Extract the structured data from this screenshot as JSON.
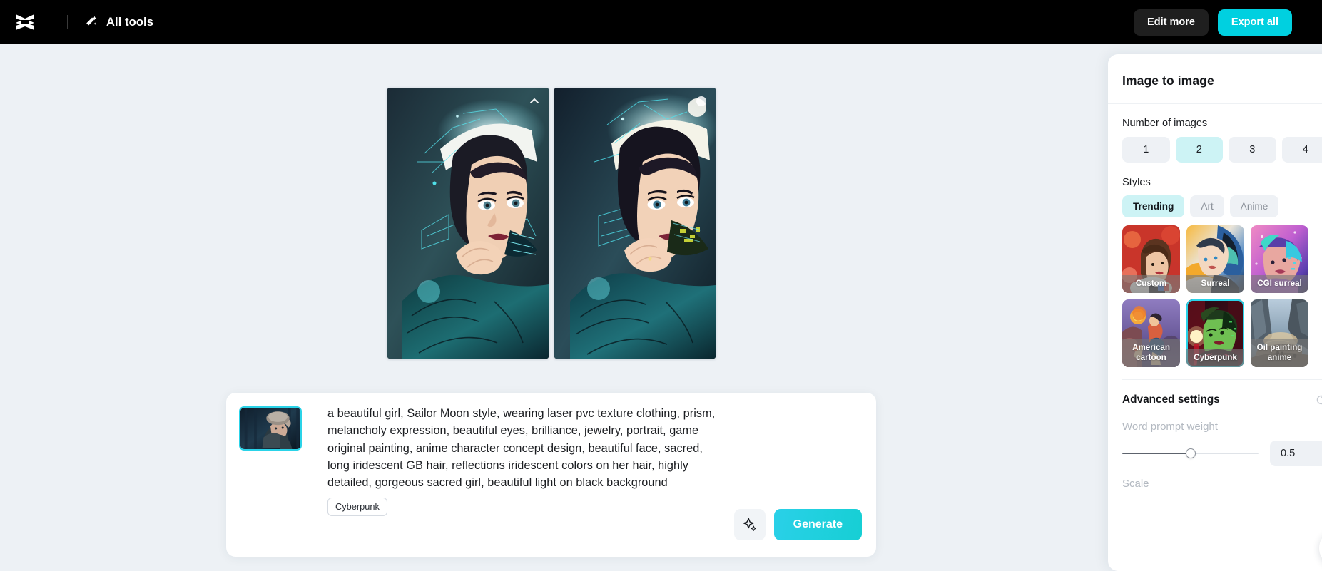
{
  "topbar": {
    "logo_icon": "capcut-logo-icon",
    "wand_icon": "magic-wand-icon",
    "all_tools_label": "All tools",
    "edit_more_label": "Edit more",
    "export_all_label": "Export all",
    "background_color": "#000000",
    "export_button_color": "#00d0e0"
  },
  "canvas": {
    "background_color": "#edf1f5",
    "results": [
      {
        "alt": "generated-image-1",
        "hover_icon": "chevron-up-icon"
      },
      {
        "alt": "generated-image-2",
        "hover_icon": "circle-icon"
      }
    ]
  },
  "prompt": {
    "reference_thumbnail_alt": "reference-image-girl-in-fur-hood",
    "text": "a beautiful girl, Sailor Moon style, wearing laser pvc texture clothing, prism, melancholy expression, beautiful eyes, brilliance, jewelry, portrait, game original painting, anime character concept design, beautiful face, sacred, long iridescent GB hair, reflections iridescent colors on her hair, highly detailed, gorgeous sacred girl, beautiful light on black background",
    "tag": "Cyberpunk",
    "magic_icon": "sparkle-icon",
    "generate_label": "Generate",
    "generate_color": "#2ad0e8"
  },
  "panel": {
    "title": "Image to image",
    "number_of_images": {
      "label": "Number of images",
      "options": [
        "1",
        "2",
        "3",
        "4"
      ],
      "selected": "2"
    },
    "styles": {
      "label": "Styles",
      "tabs": [
        {
          "label": "Trending",
          "selected": true
        },
        {
          "label": "Art",
          "selected": false
        },
        {
          "label": "Anime",
          "selected": false
        }
      ],
      "items": [
        {
          "label": "Custom",
          "selected": false
        },
        {
          "label": "Surreal",
          "selected": false
        },
        {
          "label": "CGI surreal",
          "selected": false
        },
        {
          "label": "American cartoon",
          "selected": false
        },
        {
          "label": "Cyberpunk",
          "selected": true
        },
        {
          "label": "Oil painting anime",
          "selected": false
        }
      ],
      "selected_outline_color": "#2ad3e8"
    },
    "advanced": {
      "title": "Advanced settings",
      "reset_icon": "reset-icon",
      "word_prompt_weight_label": "Word prompt weight",
      "word_prompt_weight_value": "0.5",
      "next_label": "Scale"
    }
  }
}
